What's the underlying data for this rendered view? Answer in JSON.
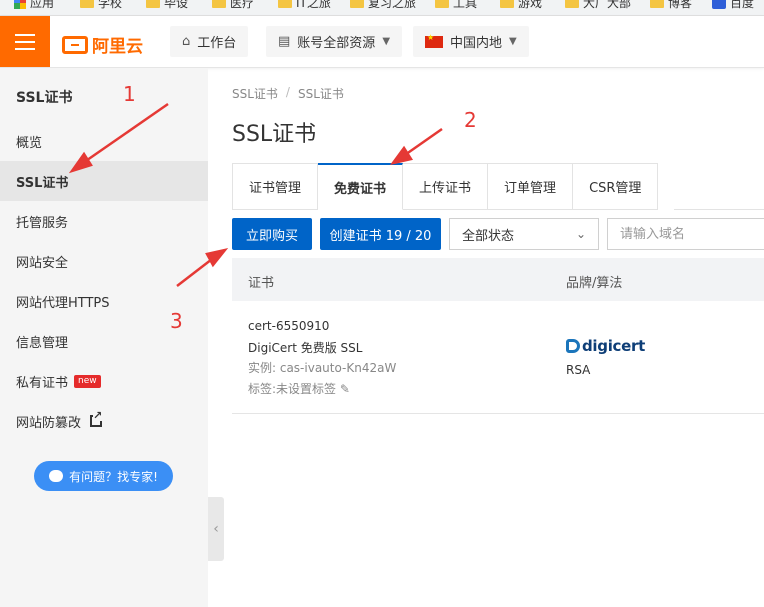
{
  "bookmarks": [
    "应用",
    "学校",
    "毕设",
    "医疗",
    "IT之旅",
    "复习之旅",
    "工具",
    "游戏",
    "大厂大部",
    "博客",
    "百度"
  ],
  "header": {
    "logo": "阿里云",
    "workbench": "工作台",
    "account_resources": "账号全部资源",
    "region": "中国内地"
  },
  "sidebar": {
    "title": "SSL证书",
    "items": [
      {
        "label": "概览"
      },
      {
        "label": "SSL证书"
      },
      {
        "label": "托管服务"
      },
      {
        "label": "网站安全"
      },
      {
        "label": "网站代理HTTPS"
      },
      {
        "label": "信息管理"
      },
      {
        "label": "私有证书",
        "badge": "new"
      },
      {
        "label": "网站防篡改"
      }
    ],
    "expert_button": "有问题？找专家!"
  },
  "breadcrumb": [
    "SSL证书",
    "SSL证书"
  ],
  "page_title": "SSL证书",
  "tabs": [
    "证书管理",
    "免费证书",
    "上传证书",
    "订单管理",
    "CSR管理"
  ],
  "toolbar": {
    "buy_label": "立即购买",
    "create_label": "创建证书 19 / 20",
    "status_select": "全部状态",
    "search_placeholder": "请输入域名"
  },
  "table": {
    "columns": [
      "证书",
      "品牌/算法"
    ],
    "rows": [
      {
        "name": "cert-6550910",
        "product": "DigiCert 免费版 SSL",
        "instance": "实例: cas-ivauto-Kn42aW",
        "tags": "标签:未设置标签",
        "brand": "digicert",
        "algorithm": "RSA"
      }
    ]
  },
  "annotations": [
    "1",
    "2",
    "3"
  ],
  "colors": {
    "brand_orange": "#ff6a00",
    "primary_blue": "#0064c8",
    "annotation_red": "#e53935"
  }
}
